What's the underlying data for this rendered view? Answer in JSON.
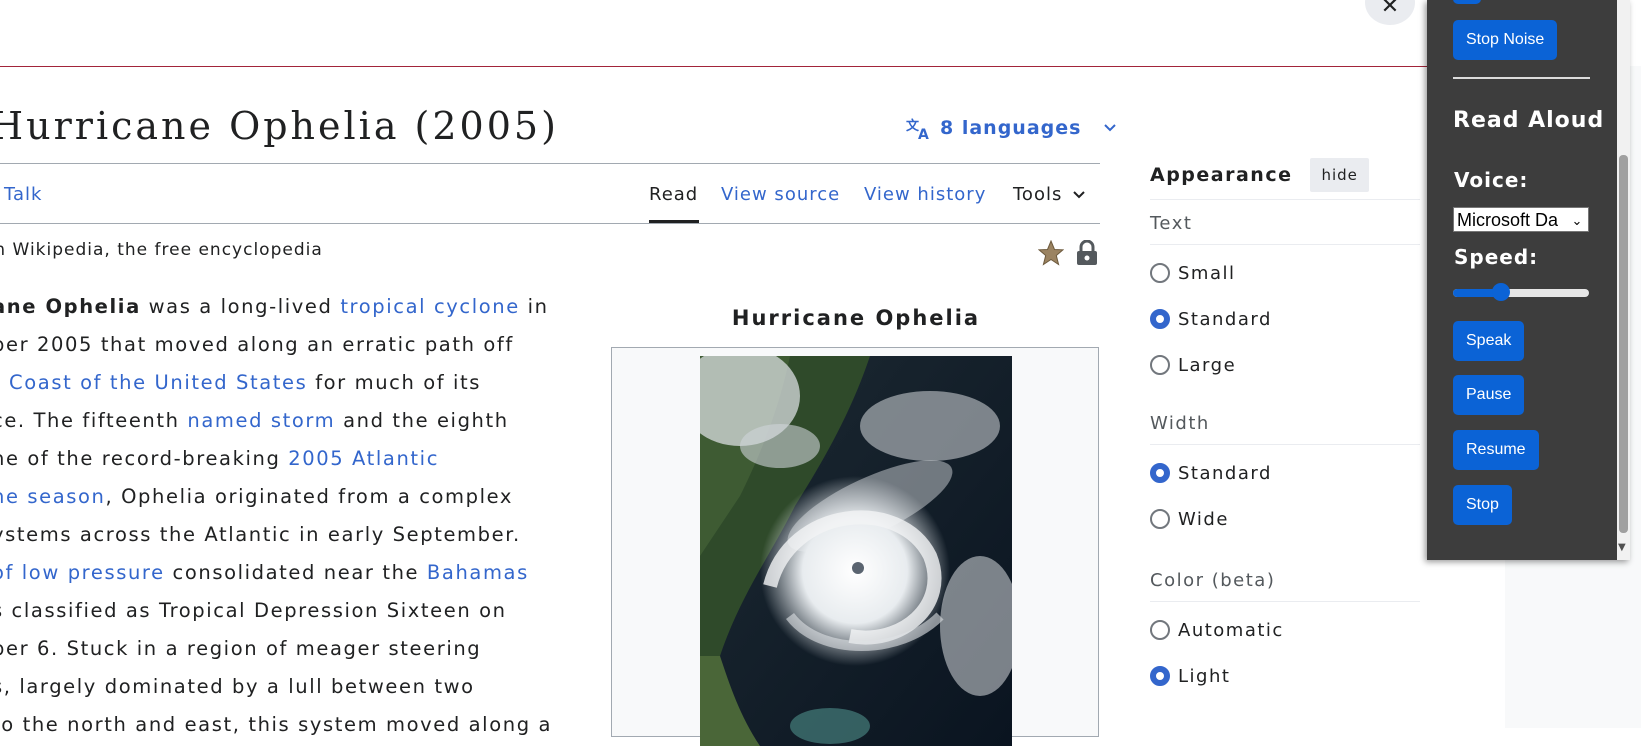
{
  "page": {
    "title": "Hurricane Ophelia (2005)",
    "languages": "8 languages",
    "tagline": "From Wikipedia, the free encyclopedia"
  },
  "tabs": {
    "talk": "Talk",
    "read": "Read",
    "view_source": "View source",
    "view_history": "View history",
    "tools": "Tools"
  },
  "article": {
    "lines": [
      [
        {
          "t": "ane Ophelia",
          "b": true
        },
        {
          "t": " was a long-lived "
        },
        {
          "t": "tropical cyclone",
          "l": true
        },
        {
          "t": " in"
        }
      ],
      [
        {
          "t": "ber 2005 that moved along an erratic path off"
        }
      ],
      [
        {
          "t": "t Coast of the United States",
          "l": true
        },
        {
          "t": " for much of its"
        }
      ],
      [
        {
          "t": "ce. The fifteenth "
        },
        {
          "t": "named storm",
          "l": true
        },
        {
          "t": " and the eighth"
        }
      ],
      [
        {
          "t": "ne of the record-breaking "
        },
        {
          "t": "2005 Atlantic",
          "l": true
        }
      ],
      [
        {
          "t": "ne season",
          "l": true
        },
        {
          "t": ", Ophelia originated from a complex"
        }
      ],
      [
        {
          "t": "ystems across the Atlantic in early September."
        }
      ],
      [
        {
          "t": " of low pressure",
          "l": true
        },
        {
          "t": " consolidated near the "
        },
        {
          "t": "Bahamas",
          "l": true
        }
      ],
      [
        {
          "t": "s classified as Tropical Depression Sixteen on"
        }
      ],
      [
        {
          "t": "ber 6. Stuck in a region of meager steering"
        }
      ],
      [
        {
          "t": "s, largely dominated by a lull between two"
        }
      ],
      [
        {
          "t": "to the north and east, this system moved along a"
        }
      ]
    ]
  },
  "infobox": {
    "title": "Hurricane Ophelia"
  },
  "appearance": {
    "title": "Appearance",
    "hide": "hide",
    "text_label": "Text",
    "text_options": [
      "Small",
      "Standard",
      "Large"
    ],
    "text_selected": "Standard",
    "width_label": "Width",
    "width_options": [
      "Standard",
      "Wide"
    ],
    "width_selected": "Standard",
    "color_label": "Color (beta)",
    "color_options": [
      "Automatic",
      "Light"
    ],
    "color_selected": "Light"
  },
  "read_aloud": {
    "stop_noise": "Stop Noise",
    "title": "Read Aloud",
    "voice_label": "Voice:",
    "voice_value": "Microsoft Da",
    "speed_label": "Speed:",
    "speed_fraction": 0.35,
    "speak": "Speak",
    "pause": "Pause",
    "resume": "Resume",
    "stop": "Stop",
    "accent_color": "#0b63d6"
  }
}
